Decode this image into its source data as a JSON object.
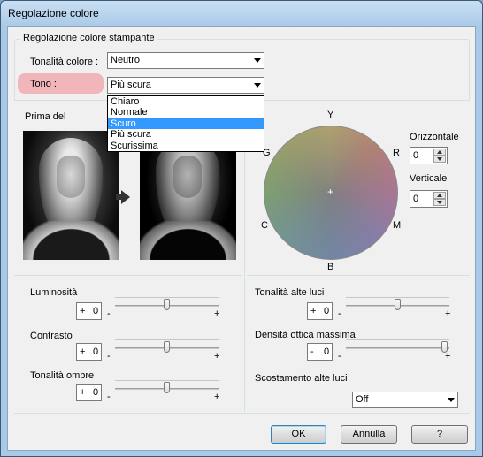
{
  "window": {
    "title": "Regolazione colore"
  },
  "group_title": "Regolazione colore stampante",
  "tonalita_colore": {
    "label": "Tonalità colore :",
    "value": "Neutro"
  },
  "tono": {
    "label": "Tono :",
    "value": "Più scura",
    "options": [
      "Chiaro",
      "Normale",
      "Scuro",
      "Più scura",
      "Scurissima"
    ],
    "highlighted": "Scuro"
  },
  "preview": {
    "label": "Prima del"
  },
  "color_wheel": {
    "labels": {
      "top": "Y",
      "right_top": "R",
      "right_bottom": "M",
      "bottom": "B",
      "left_bottom": "C",
      "left_top": "G"
    }
  },
  "orizzontale": {
    "label": "Orizzontale",
    "value": "0"
  },
  "verticale": {
    "label": "Verticale",
    "value": "0"
  },
  "sliders_left": [
    {
      "label": "Luminosità",
      "sign": "+",
      "value": "0",
      "minus": "-",
      "plus": "+",
      "level": 0.5
    },
    {
      "label": "Contrasto",
      "sign": "+",
      "value": "0",
      "minus": "-",
      "plus": "+",
      "level": 0.5
    },
    {
      "label": "Tonalità ombre",
      "sign": "+",
      "value": "0",
      "minus": "-",
      "plus": "+",
      "level": 0.5
    }
  ],
  "sliders_right": [
    {
      "label": "Tonalità alte luci",
      "sign": "+",
      "value": "0",
      "minus": "-",
      "plus": "+",
      "level": 0.5
    },
    {
      "label": "Densità ottica massima",
      "sign": "-",
      "value": "0",
      "minus": "-",
      "plus": "+",
      "level": 0.98
    }
  ],
  "scostamento": {
    "label": "Scostamento alte luci",
    "value": "Off"
  },
  "buttons": {
    "ok": "OK",
    "annulla": "Annulla",
    "help": "?"
  }
}
